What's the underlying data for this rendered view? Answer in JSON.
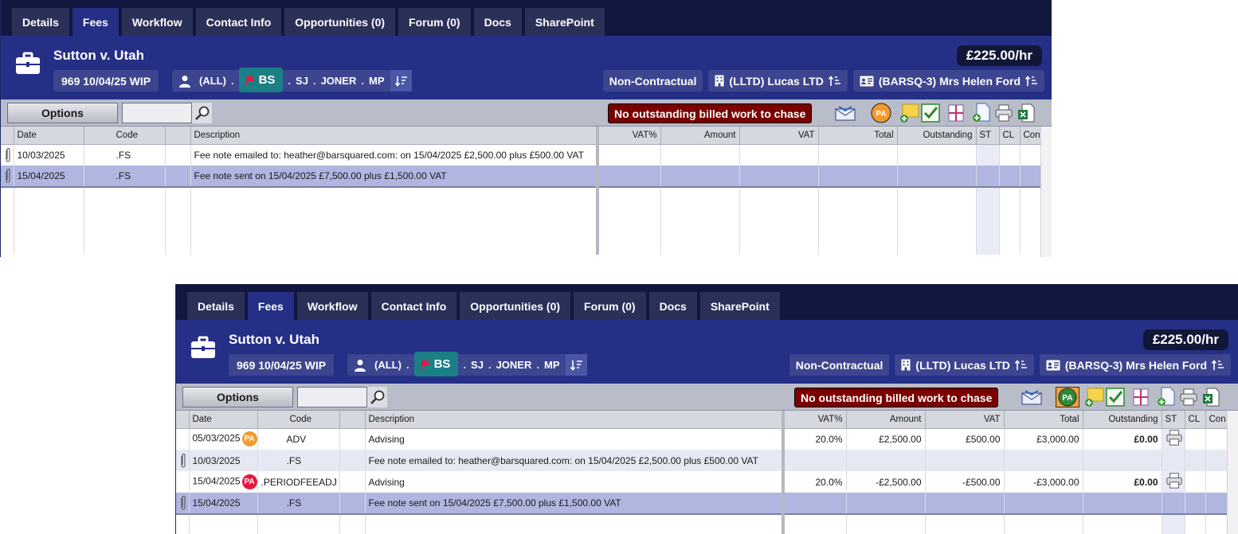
{
  "tabs": [
    "Details",
    "Fees",
    "Workflow",
    "Contact Info",
    "Opportunities (0)",
    "Forum (0)",
    "Docs",
    "SharePoint"
  ],
  "active_tab": "Fees",
  "header": {
    "case_title": "Sutton v. Utah",
    "rate": "£225.00/hr",
    "wip": "969 10/04/25 WIP",
    "team_all": "(ALL)",
    "team_bs": "BS",
    "team_sj": "SJ",
    "team_joner": "JONER",
    "team_mp": "MP",
    "contract": "Non-Contractual",
    "company": "(LLTD) Lucas LTD",
    "contact": "(BARSQ-3) Mrs Helen Ford"
  },
  "toolbar": {
    "options_label": "Options",
    "search_placeholder": "",
    "alert": "No outstanding billed work to chase",
    "pa_label": "PA"
  },
  "columns": {
    "date": "Date",
    "code": "Code",
    "description": "Description",
    "vat_pct": "VAT%",
    "amount": "Amount",
    "vat": "VAT",
    "total": "Total",
    "outstanding": "Outstanding",
    "st": "ST",
    "cl": "CL",
    "con": "Con"
  },
  "window1_rows": [
    {
      "date": "10/03/2025",
      "code": ".FS",
      "description": "Fee note emailed to: heather@barsquared.com: on 15/04/2025 £2,500.00 plus £500.00 VAT",
      "attachment": true
    },
    {
      "date": "15/04/2025",
      "code": ".FS",
      "description": "Fee note sent on 15/04/2025 £7,500.00 plus £1,500.00 VAT",
      "attachment": true,
      "selected": true
    }
  ],
  "window2_rows": [
    {
      "date": "05/03/2025",
      "badge": "PA",
      "code": "ADV",
      "description": "Advising",
      "vat_pct": "20.0%",
      "amount": "£2,500.00",
      "vat": "£500.00",
      "total": "£3,000.00",
      "outstanding": "£0.00"
    },
    {
      "date": "10/03/2025",
      "code": ".FS",
      "description": "Fee note emailed to: heather@barsquared.com: on 15/04/2025 £2,500.00 plus £500.00 VAT",
      "attachment": true
    },
    {
      "date": "15/04/2025",
      "badge": "PA",
      "code": ".PERIODFEEADJ",
      "description": "Advising",
      "vat_pct": "20.0%",
      "amount": "-£2,500.00",
      "vat": "-£500.00",
      "total": "-£3,000.00",
      "outstanding": "£0.00"
    },
    {
      "date": "15/04/2025",
      "code": ".FS",
      "description": "Fee note sent on 15/04/2025 £7,500.00 plus £1,500.00 VAT",
      "attachment": true,
      "selected": true
    }
  ],
  "colors": {
    "tabbar_bg": "#12173f",
    "header_bg": "#252f85",
    "chip_bg": "#3d4590",
    "bs_bg": "#1b7f86",
    "alert_bg": "#7a0000",
    "selected_row": "#b0b6e0",
    "badge_orange": "#f29a2c",
    "badge_red": "#e8163f"
  },
  "icons": [
    "briefcase-icon",
    "person-icon",
    "red-flag-icon",
    "sort-desc-icon",
    "building-icon",
    "id-card-icon",
    "sort-asc-icon",
    "search-icon",
    "email-icon",
    "pa-icon",
    "new-note-icon",
    "checkmark-icon",
    "grid-icon",
    "new-document-icon",
    "printer-icon",
    "excel-icon",
    "paperclip-icon"
  ]
}
